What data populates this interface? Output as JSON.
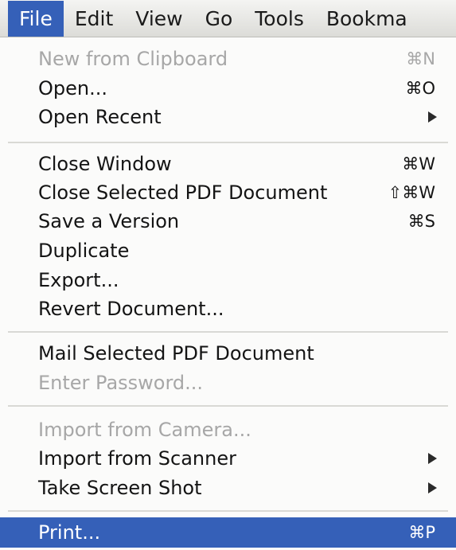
{
  "menubar": {
    "items": [
      {
        "label": "File",
        "active": true
      },
      {
        "label": "Edit"
      },
      {
        "label": "View"
      },
      {
        "label": "Go"
      },
      {
        "label": "Tools"
      },
      {
        "label": "Bookma"
      }
    ]
  },
  "file_menu": {
    "groups": [
      [
        {
          "label": "New from Clipboard",
          "shortcut": "⌘N",
          "enabled": false
        },
        {
          "label": "Open...",
          "shortcut": "⌘O",
          "enabled": true
        },
        {
          "label": "Open Recent",
          "submenu": true,
          "enabled": true
        }
      ],
      [
        {
          "label": "Close Window",
          "shortcut": "⌘W",
          "enabled": true
        },
        {
          "label": "Close Selected PDF Document",
          "shortcut": "⇧⌘W",
          "enabled": true
        },
        {
          "label": "Save a Version",
          "shortcut": "⌘S",
          "enabled": true
        },
        {
          "label": "Duplicate",
          "enabled": true
        },
        {
          "label": "Export...",
          "enabled": true
        },
        {
          "label": "Revert Document...",
          "enabled": true
        }
      ],
      [
        {
          "label": "Mail Selected PDF Document",
          "enabled": true
        },
        {
          "label": "Enter Password...",
          "enabled": false
        }
      ],
      [
        {
          "label": "Import from Camera...",
          "enabled": false
        },
        {
          "label": "Import from Scanner",
          "submenu": true,
          "enabled": true
        },
        {
          "label": "Take Screen Shot",
          "submenu": true,
          "enabled": true
        }
      ],
      [
        {
          "label": "Print...",
          "shortcut": "⌘P",
          "enabled": true,
          "highlighted": true
        }
      ]
    ]
  }
}
